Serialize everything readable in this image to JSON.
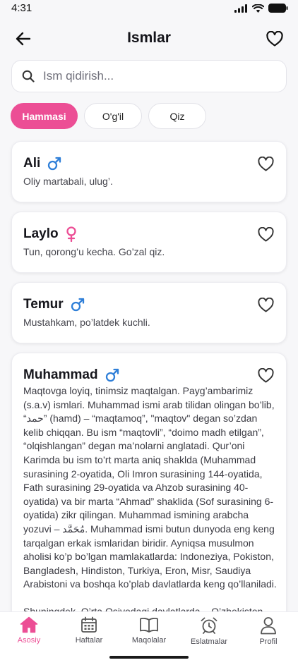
{
  "status": {
    "time": "4:31"
  },
  "header": {
    "title": "Ismlar"
  },
  "search": {
    "placeholder": "Ism qidirish..."
  },
  "filters": [
    "Hammasi",
    "O'g'il",
    "Qiz"
  ],
  "colors": {
    "accent": "#ec4e95",
    "male": "#2f7fd8",
    "female": "#ec4e95"
  },
  "names": [
    {
      "name": "Ali",
      "gender": "male",
      "meaning": "Oliy martabali, ulug’."
    },
    {
      "name": "Laylo",
      "gender": "female",
      "meaning": "Tun, qorong’u kecha. Go’zal qiz."
    },
    {
      "name": "Temur",
      "gender": "male",
      "meaning": "Mustahkam, po’latdek kuchli."
    },
    {
      "name": "Muhammad",
      "gender": "male",
      "meaning_paragraphs": [
        "Maqtovga loyiq, tinimsiz maqtalgan. Payg’ambarimiz (s.a.v) ismlari. Muhammad ismi arab tilidan olingan bo’lib, “حمد” (hamd) – “maqtamoq”, \"maqtov\" degan so’zdan kelib chiqqan. Bu ism “maqtovli”, “doimo madh etilgan”, “olqishlangan” degan ma’nolarni anglatadi. Qur’oni Karimda bu ism to’rt marta aniq shaklda (Muhammad surasining 2-oyatida, Oli Imron surasining 144-oyatida, Fath surasining 29-oyatida va Ahzob surasining 40-oyatida) va bir marta “Ahmad” shaklida (Sof surasining 6-oyatida) zikr qilingan. Muhammad ismining arabcha yozuvi – مُحَمَّد. Muhammad ismi butun dunyoda eng keng tarqalgan erkak ismlaridan biridir. Ayniqsa musulmon aholisi ko’p bo’lgan mamlakatlarda: Indoneziya, Pokiston, Bangladesh, Hindiston, Turkiya, Eron, Misr, Saudiya Arabistoni va boshqa ko’plab davlatlarda keng qo’llaniladi.",
        "Shuningdek, O’rta Osiyodagi davlatlarda – O’zbekiston,"
      ]
    }
  ],
  "nav": [
    {
      "label": "Asosiy",
      "icon": "home-icon",
      "active": true
    },
    {
      "label": "Haftalar",
      "icon": "calendar-icon",
      "active": false
    },
    {
      "label": "Maqolalar",
      "icon": "book-icon",
      "active": false
    },
    {
      "label": "Eslatmalar",
      "icon": "alarm-clock-icon",
      "active": false
    },
    {
      "label": "Profil",
      "icon": "profile-icon",
      "active": false
    }
  ]
}
